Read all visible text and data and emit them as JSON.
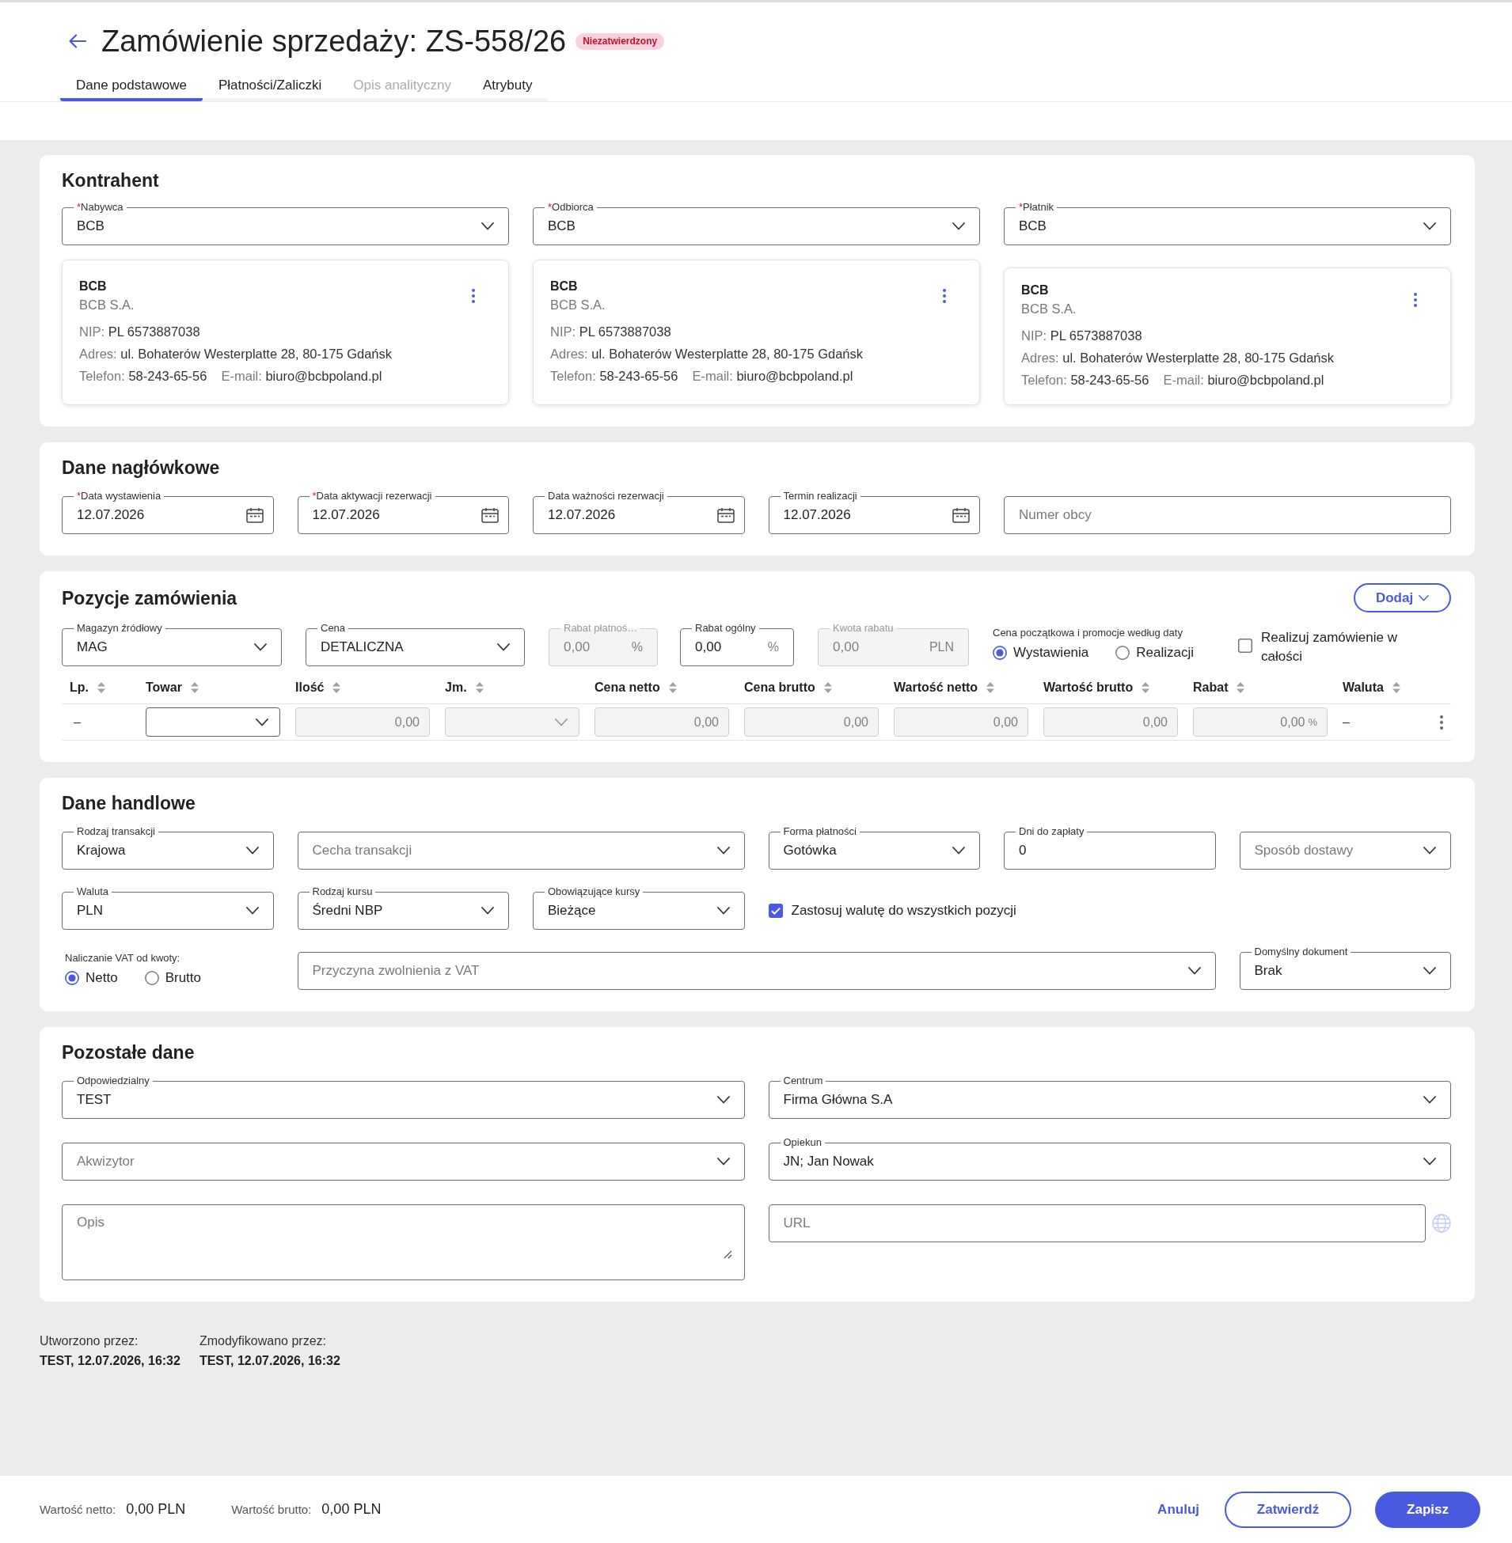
{
  "header": {
    "title": "Zamówienie sprzedaży: ZS-558/26",
    "badge": "Niezatwierdzony"
  },
  "tabs": [
    {
      "label": "Dane podstawowe",
      "selected": true,
      "disabled": false
    },
    {
      "label": "Płatności/Zaliczki",
      "selected": false,
      "disabled": false
    },
    {
      "label": "Opis analityczny",
      "selected": false,
      "disabled": true
    },
    {
      "label": "Atrybuty",
      "selected": false,
      "disabled": false
    }
  ],
  "kontrahent": {
    "title": "Kontrahent",
    "parties": [
      {
        "field": {
          "kind": "select",
          "required_mark": "*",
          "label": "Nabywca",
          "value": "BCB"
        },
        "card": {
          "name": "BCB",
          "full_name": "BCB S.A.",
          "lines": [
            [
              {
                "label": "NIP:",
                "value": "PL 6573887038"
              }
            ],
            [
              {
                "label": "Adres:",
                "value": "ul. Bohaterów Westerplatte 28, 80-175 Gdańsk"
              }
            ],
            [
              {
                "label": "Telefon:",
                "value": "58-243-65-56"
              },
              {
                "label": "E-mail:",
                "value": "biuro@bcbpoland.pl"
              }
            ]
          ]
        }
      },
      {
        "field": {
          "kind": "select",
          "required_mark": "*",
          "label": "Odbiorca",
          "value": "BCB"
        },
        "card": {
          "name": "BCB",
          "full_name": "BCB S.A.",
          "lines": [
            [
              {
                "label": "NIP:",
                "value": "PL 6573887038"
              }
            ],
            [
              {
                "label": "Adres:",
                "value": "ul. Bohaterów Westerplatte 28, 80-175 Gdańsk"
              }
            ],
            [
              {
                "label": "Telefon:",
                "value": "58-243-65-56"
              },
              {
                "label": "E-mail:",
                "value": "biuro@bcbpoland.pl"
              }
            ]
          ]
        }
      },
      {
        "field": {
          "kind": "select",
          "required_mark": "*",
          "label": "Płatnik",
          "value": "BCB"
        },
        "card": {
          "name": "BCB",
          "full_name": "BCB S.A.",
          "lines": [
            [
              {
                "label": "NIP:",
                "value": "PL 6573887038"
              }
            ],
            [
              {
                "label": "Adres:",
                "value": "ul. Bohaterów Westerplatte 28, 80-175 Gdańsk"
              }
            ],
            [
              {
                "label": "Telefon:",
                "value": "58-243-65-56"
              },
              {
                "label": "E-mail:",
                "value": "biuro@bcbpoland.pl"
              }
            ]
          ]
        }
      }
    ]
  },
  "naglowek": {
    "title": "Dane nagłówkowe",
    "fields": [
      {
        "kind": "date",
        "required_mark": "*",
        "label": "Data wystawienia",
        "value": "12.07.2026"
      },
      {
        "kind": "date",
        "required_mark": "*",
        "label": "Data aktywacji rezerwacji",
        "value": "12.07.2026"
      },
      {
        "kind": "date",
        "label": "Data ważności rezerwacji",
        "value": "12.07.2026"
      },
      {
        "kind": "date",
        "label": "Termin realizacji",
        "value": "12.07.2026"
      },
      {
        "kind": "text",
        "placeholder": "Numer obcy"
      }
    ]
  },
  "pozycje": {
    "title": "Pozycje zamówienia",
    "add_button": {
      "label": "Dodaj"
    },
    "filters": [
      {
        "kind": "select",
        "label": "Magazyn źródłowy",
        "value": "MAG",
        "disabled": false
      },
      {
        "kind": "select",
        "label": "Cena",
        "value": "DETALICZNA",
        "disabled": false
      },
      {
        "kind": "number",
        "label": "Rabat płatnoś…",
        "value": "0,00",
        "suffix": "%",
        "disabled": true
      },
      {
        "kind": "number",
        "label": "Rabat ogólny",
        "value": "0,00",
        "suffix": "%",
        "disabled": false
      },
      {
        "kind": "number",
        "label": "Kwota rabatu",
        "value": "0,00",
        "suffix": "PLN",
        "disabled": true
      },
      {
        "kind": "radio",
        "label": "Cena początkowa i promocje według daty",
        "disabled": false,
        "options": [
          {
            "label": "Wystawienia",
            "selected": true
          },
          {
            "label": "Realizacji",
            "selected": false
          }
        ]
      },
      {
        "kind": "checkbox",
        "label": "Realizuj zamówienie w całości",
        "checked": false,
        "disabled": false
      }
    ],
    "table": {
      "columns": [
        "Lp.",
        "Towar",
        "Ilość",
        "Jm.",
        "Cena netto",
        "Cena brutto",
        "Wartość netto",
        "Wartość brutto",
        "Rabat",
        "Waluta"
      ],
      "rows": [
        {
          "cells": [
            {
              "kind": "text",
              "value": "–",
              "disabled": false
            },
            {
              "kind": "select",
              "disabled": false
            },
            {
              "kind": "input",
              "value": "0,00",
              "disabled": true
            },
            {
              "kind": "select",
              "disabled": true
            },
            {
              "kind": "input",
              "value": "0,00",
              "disabled": true
            },
            {
              "kind": "input",
              "value": "0,00",
              "disabled": true
            },
            {
              "kind": "input",
              "value": "0,00",
              "disabled": true
            },
            {
              "kind": "input",
              "value": "0,00",
              "disabled": true
            },
            {
              "kind": "input",
              "value": "0,00",
              "suffix": "%",
              "disabled": true
            },
            {
              "kind": "text",
              "value": "–",
              "disabled": false
            }
          ]
        }
      ]
    }
  },
  "handlowe": {
    "title": "Dane handlowe",
    "fields": [
      {
        "kind": "select",
        "label": "Rodzaj transakcji",
        "value": "Krajowa"
      },
      {
        "kind": "select",
        "placeholder": "Cecha transakcji"
      },
      {
        "kind": "select",
        "label": "Forma płatności",
        "value": "Gotówka"
      },
      {
        "kind": "text",
        "label": "Dni do zapłaty",
        "value": "0"
      },
      {
        "kind": "select",
        "placeholder": "Sposób dostawy"
      },
      {
        "kind": "select",
        "label": "Waluta",
        "value": "PLN"
      },
      {
        "kind": "select",
        "label": "Rodzaj kursu",
        "value": "Średni NBP"
      },
      {
        "kind": "select",
        "label": "Obowiązujące kursy",
        "value": "Bieżące"
      },
      {
        "kind": "checkbox",
        "label": "Zastosuj walutę do wszystkich pozycji",
        "checked": true
      },
      {
        "kind": "radio",
        "label": "Naliczanie VAT od kwoty:",
        "options": [
          {
            "label": "Netto",
            "selected": true
          },
          {
            "label": "Brutto",
            "selected": false
          }
        ]
      },
      {
        "kind": "select",
        "placeholder": "Przyczyna zwolnienia z VAT"
      },
      {
        "kind": "select",
        "label": "Domyślny dokument",
        "value": "Brak"
      }
    ]
  },
  "pozostale": {
    "title": "Pozostałe dane",
    "columns": [
      [
        {
          "kind": "select",
          "label": "Odpowiedzialny",
          "value": "TEST"
        },
        {
          "kind": "select",
          "placeholder": "Akwizytor"
        },
        {
          "kind": "textarea",
          "placeholder": "Opis"
        }
      ],
      [
        {
          "kind": "select",
          "label": "Centrum",
          "value": "Firma Główna S.A"
        },
        {
          "kind": "select",
          "label": "Opiekun",
          "value": "JN; Jan Nowak"
        },
        {
          "kind": "url",
          "placeholder": "URL"
        }
      ]
    ]
  },
  "meta": [
    {
      "label": "Utworzono przez:",
      "value": "TEST, 12.07.2026, 16:32"
    },
    {
      "label": "Zmodyfikowano przez:",
      "value": "TEST, 12.07.2026, 16:32"
    }
  ],
  "footer": {
    "totals": [
      {
        "label": "Wartość netto:",
        "value": "0,00 PLN"
      },
      {
        "label": "Wartość brutto:",
        "value": "0,00 PLN"
      }
    ],
    "buttons": [
      {
        "label": "Anuluj",
        "kind": "text"
      },
      {
        "label": "Zatwierdź",
        "kind": "outlined"
      },
      {
        "label": "Zapisz",
        "kind": "filled"
      }
    ]
  }
}
